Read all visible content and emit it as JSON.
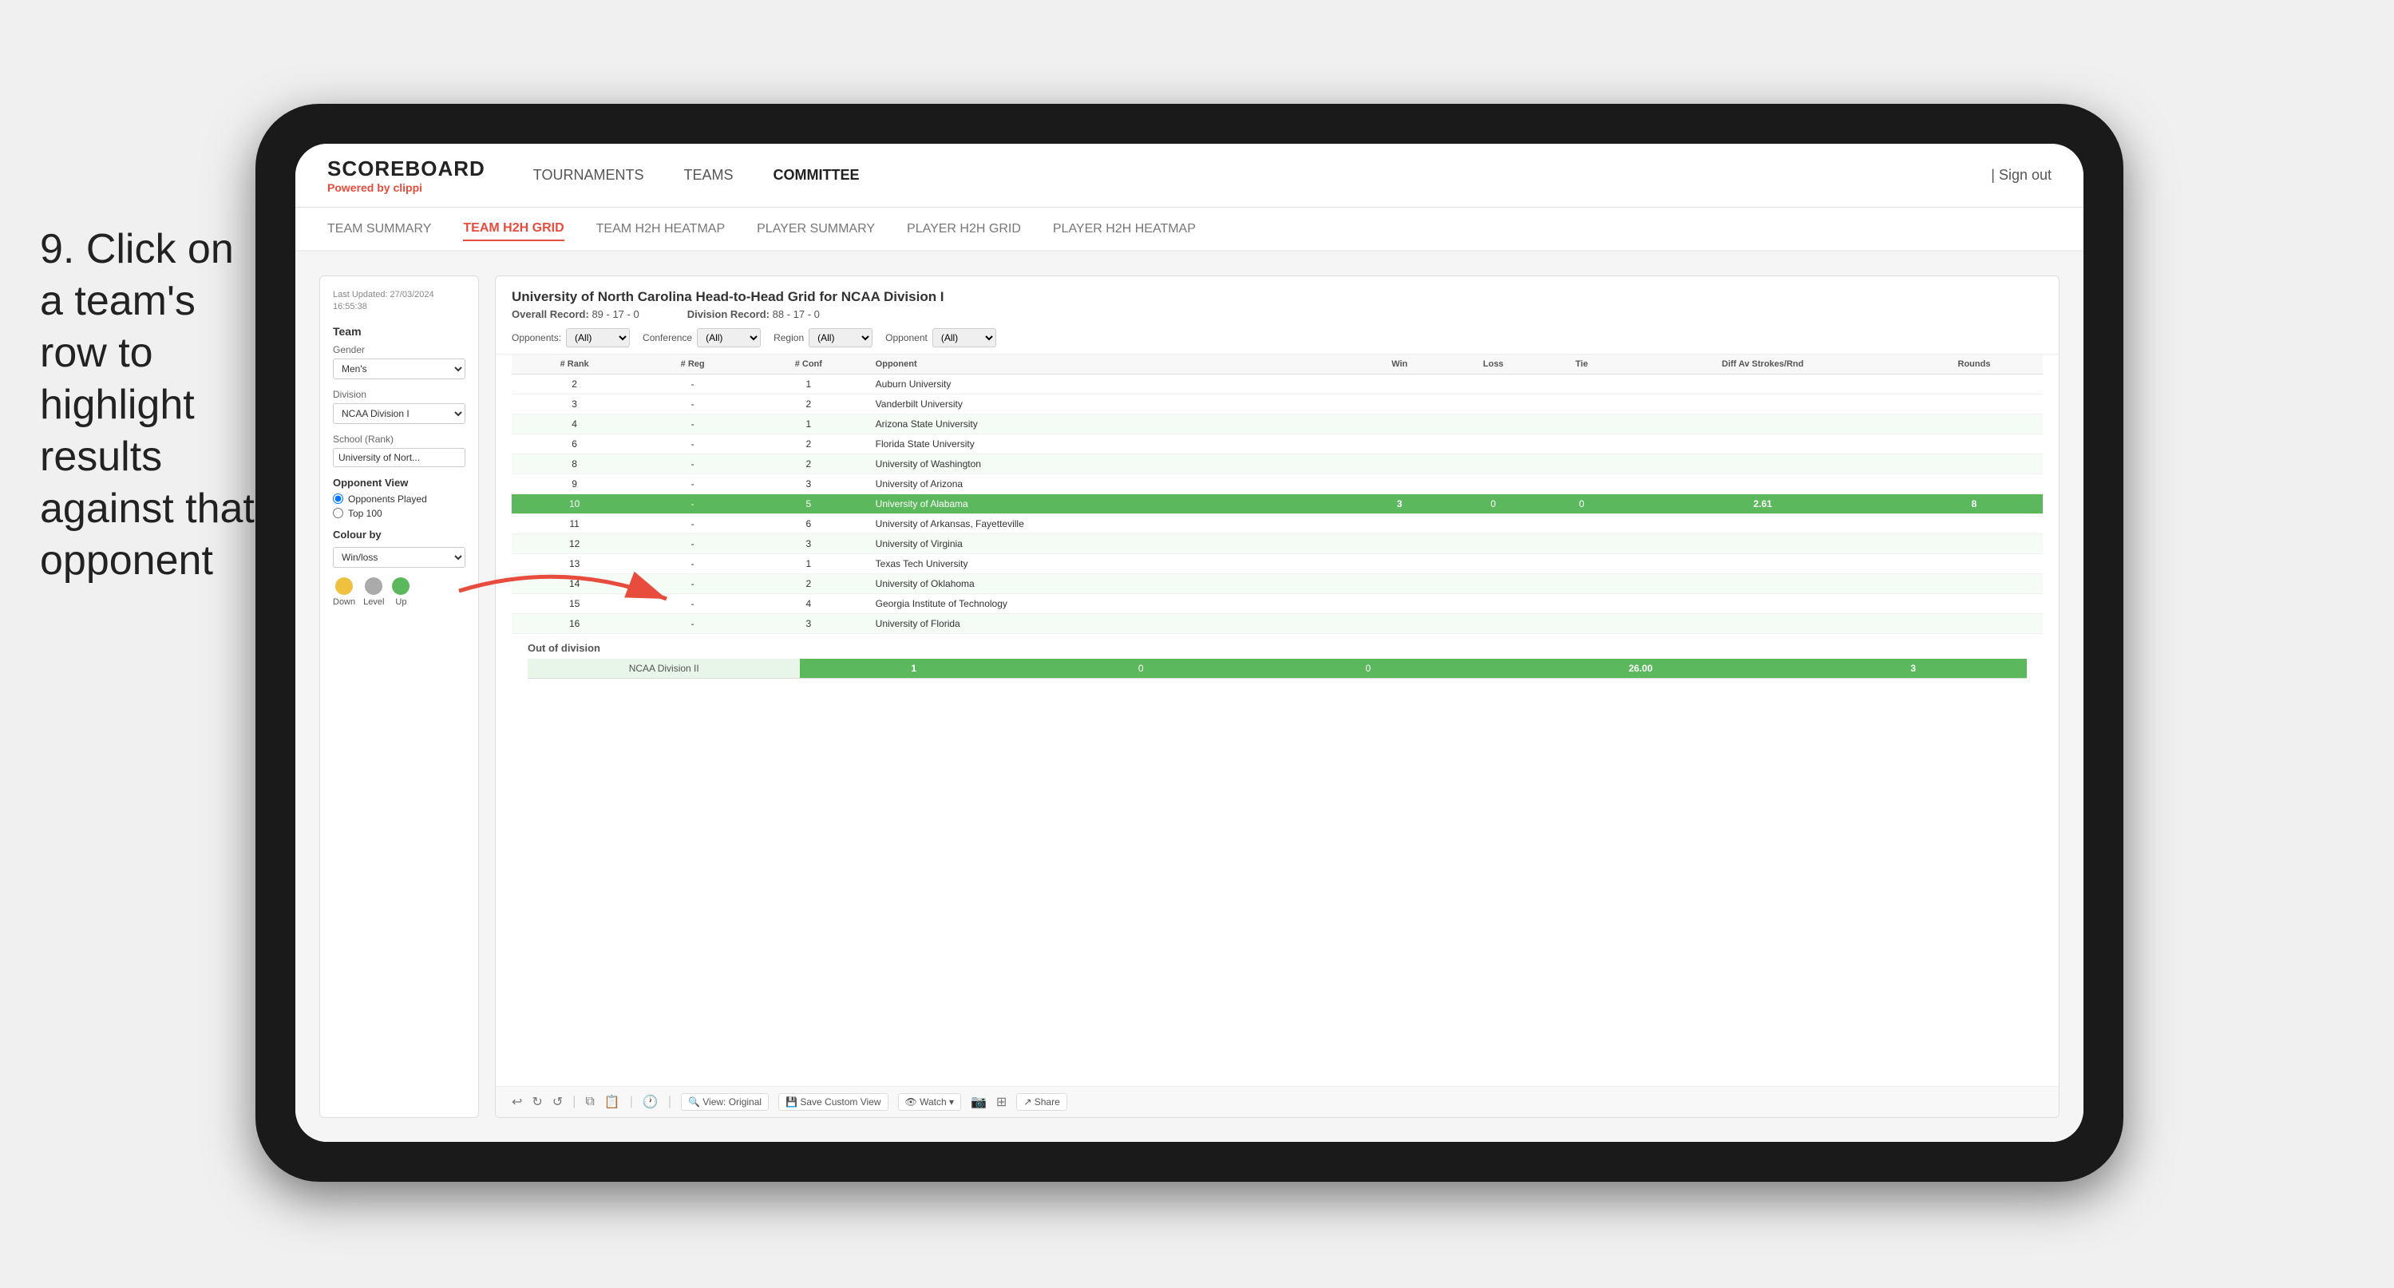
{
  "instruction": {
    "text": "9. Click on a team's row to highlight results against that opponent"
  },
  "nav": {
    "logo": "SCOREBOARD",
    "powered_by": "Powered by",
    "brand": "clippi",
    "links": [
      "TOURNAMENTS",
      "TEAMS",
      "COMMITTEE"
    ],
    "sign_out": "Sign out"
  },
  "sub_nav": {
    "links": [
      "TEAM SUMMARY",
      "TEAM H2H GRID",
      "TEAM H2H HEATMAP",
      "PLAYER SUMMARY",
      "PLAYER H2H GRID",
      "PLAYER H2H HEATMAP"
    ],
    "active": "TEAM H2H GRID"
  },
  "left_panel": {
    "last_updated_label": "Last Updated: 27/03/2024",
    "last_updated_time": "16:55:38",
    "team_label": "Team",
    "gender_label": "Gender",
    "gender_value": "Men's",
    "division_label": "Division",
    "division_value": "NCAA Division I",
    "school_label": "School (Rank)",
    "school_value": "University of Nort...",
    "opponent_view_label": "Opponent View",
    "radio1": "Opponents Played",
    "radio2": "Top 100",
    "colour_by_label": "Colour by",
    "colour_by_value": "Win/loss",
    "legend": [
      {
        "label": "Down",
        "color": "yellow"
      },
      {
        "label": "Level",
        "color": "gray"
      },
      {
        "label": "Up",
        "color": "green"
      }
    ]
  },
  "grid": {
    "title": "University of North Carolina Head-to-Head Grid for NCAA Division I",
    "overall_record_label": "Overall Record:",
    "overall_record": "89 - 17 - 0",
    "division_record_label": "Division Record:",
    "division_record": "88 - 17 - 0",
    "filters": {
      "opponents_label": "Opponents:",
      "opponents_value": "(All)",
      "conference_label": "Conference",
      "conference_value": "(All)",
      "region_label": "Region",
      "region_value": "(All)",
      "opponent_label": "Opponent",
      "opponent_value": "(All)"
    },
    "columns": [
      "# Rank",
      "# Reg",
      "# Conf",
      "Opponent",
      "Win",
      "Loss",
      "Tie",
      "Diff Av Strokes/Rnd",
      "Rounds"
    ],
    "rows": [
      {
        "rank": "2",
        "reg": "-",
        "conf": "1",
        "opponent": "Auburn University",
        "win": "",
        "loss": "",
        "tie": "",
        "diff": "",
        "rounds": "",
        "style": "normal"
      },
      {
        "rank": "3",
        "reg": "-",
        "conf": "2",
        "opponent": "Vanderbilt University",
        "win": "",
        "loss": "",
        "tie": "",
        "diff": "",
        "rounds": "",
        "style": "normal"
      },
      {
        "rank": "4",
        "reg": "-",
        "conf": "1",
        "opponent": "Arizona State University",
        "win": "",
        "loss": "",
        "tie": "",
        "diff": "",
        "rounds": "",
        "style": "light"
      },
      {
        "rank": "6",
        "reg": "-",
        "conf": "2",
        "opponent": "Florida State University",
        "win": "",
        "loss": "",
        "tie": "",
        "diff": "",
        "rounds": "",
        "style": "normal"
      },
      {
        "rank": "8",
        "reg": "-",
        "conf": "2",
        "opponent": "University of Washington",
        "win": "",
        "loss": "",
        "tie": "",
        "diff": "",
        "rounds": "",
        "style": "light"
      },
      {
        "rank": "9",
        "reg": "-",
        "conf": "3",
        "opponent": "University of Arizona",
        "win": "",
        "loss": "",
        "tie": "",
        "diff": "",
        "rounds": "",
        "style": "normal"
      },
      {
        "rank": "10",
        "reg": "-",
        "conf": "5",
        "opponent": "University of Alabama",
        "win": "3",
        "loss": "0",
        "tie": "0",
        "diff": "2.61",
        "rounds": "8",
        "style": "highlighted"
      },
      {
        "rank": "11",
        "reg": "-",
        "conf": "6",
        "opponent": "University of Arkansas, Fayetteville",
        "win": "",
        "loss": "",
        "tie": "",
        "diff": "",
        "rounds": "",
        "style": "normal"
      },
      {
        "rank": "12",
        "reg": "-",
        "conf": "3",
        "opponent": "University of Virginia",
        "win": "",
        "loss": "",
        "tie": "",
        "diff": "",
        "rounds": "",
        "style": "light"
      },
      {
        "rank": "13",
        "reg": "-",
        "conf": "1",
        "opponent": "Texas Tech University",
        "win": "",
        "loss": "",
        "tie": "",
        "diff": "",
        "rounds": "",
        "style": "normal"
      },
      {
        "rank": "14",
        "reg": "-",
        "conf": "2",
        "opponent": "University of Oklahoma",
        "win": "",
        "loss": "",
        "tie": "",
        "diff": "",
        "rounds": "",
        "style": "light"
      },
      {
        "rank": "15",
        "reg": "-",
        "conf": "4",
        "opponent": "Georgia Institute of Technology",
        "win": "",
        "loss": "",
        "tie": "",
        "diff": "",
        "rounds": "",
        "style": "normal"
      },
      {
        "rank": "16",
        "reg": "-",
        "conf": "3",
        "opponent": "University of Florida",
        "win": "",
        "loss": "",
        "tie": "",
        "diff": "",
        "rounds": "",
        "style": "light"
      }
    ],
    "out_of_division_label": "Out of division",
    "out_division_row": {
      "division": "NCAA Division II",
      "win": "1",
      "loss": "0",
      "tie": "0",
      "diff": "26.00",
      "rounds": "3"
    }
  },
  "toolbar": {
    "view_original": "View: Original",
    "save_custom": "Save Custom View",
    "watch": "Watch ▾",
    "share": "Share"
  }
}
